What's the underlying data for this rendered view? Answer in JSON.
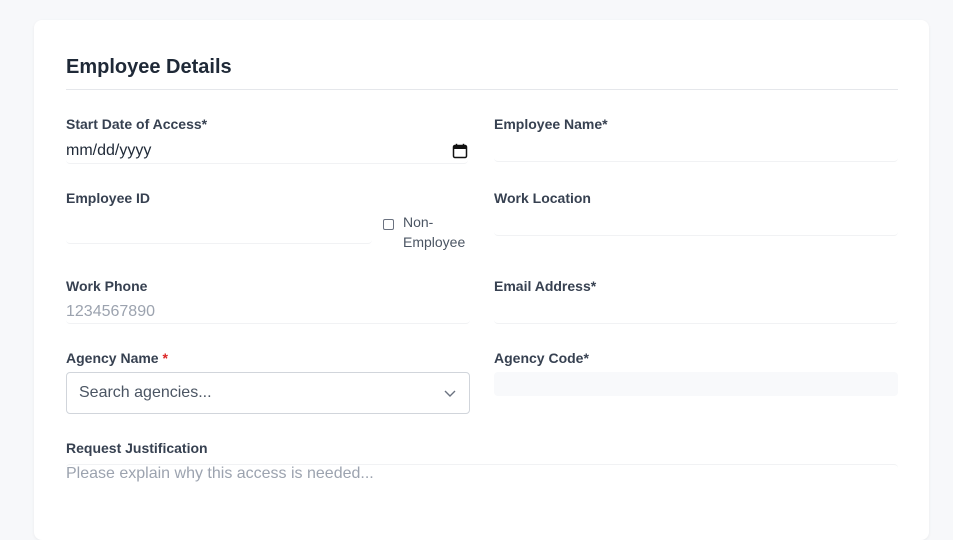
{
  "section": {
    "title": "Employee Details"
  },
  "fields": {
    "start_date": {
      "label": "Start Date of Access*",
      "value": "mm/dd/yyyy"
    },
    "employee_name": {
      "label": "Employee Name*",
      "value": ""
    },
    "employee_id": {
      "label": "Employee ID",
      "value": ""
    },
    "non_employee": {
      "label": "Non-Employee",
      "checked": false
    },
    "work_location": {
      "label": "Work Location",
      "value": ""
    },
    "work_phone": {
      "label": "Work Phone",
      "placeholder": "1234567890",
      "value": ""
    },
    "email": {
      "label": "Email Address*",
      "value": ""
    },
    "agency_name": {
      "label": "Agency Name",
      "required_mark": "*",
      "placeholder": "Search agencies..."
    },
    "agency_code": {
      "label": "Agency Code*",
      "value": ""
    },
    "justification": {
      "label": "Request Justification",
      "placeholder": "Please explain why this access is needed..."
    }
  },
  "colors": {
    "required": "#dc2626",
    "background": "#f7f8fa",
    "card": "#ffffff"
  }
}
